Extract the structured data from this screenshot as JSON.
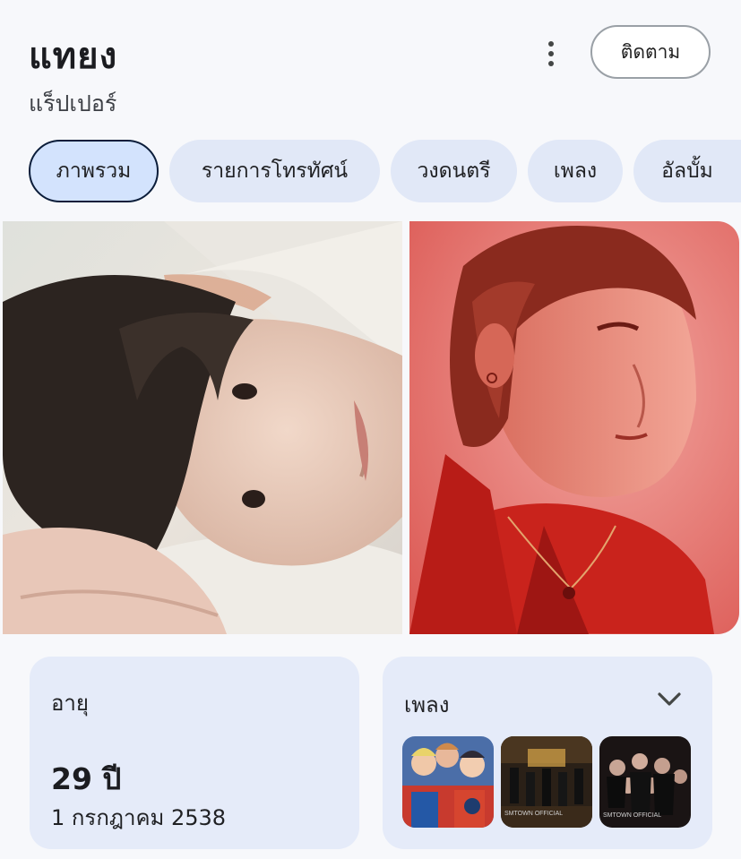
{
  "header": {
    "title": "แทยง",
    "subtitle": "แร็ปเปอร์",
    "follow_label": "ติดตาม"
  },
  "tabs": [
    {
      "label": "ภาพรวม",
      "active": true
    },
    {
      "label": "รายการโทรทัศน์",
      "active": false
    },
    {
      "label": "วงดนตรี",
      "active": false
    },
    {
      "label": "เพลง",
      "active": false
    },
    {
      "label": "อัลบั้ม",
      "active": false
    }
  ],
  "age_card": {
    "label": "อายุ",
    "value": "29 ปี",
    "birth_date": "1 กรกฎาคม 2538"
  },
  "songs_card": {
    "label": "เพลง",
    "thumbnail_captions": [
      "SMTOWN OFFICIAL",
      "SMTOWN OFFICIAL"
    ]
  },
  "colors": {
    "background": "#f7f8fb",
    "chip": "#e1e8f7",
    "chip_active": "#d3e3fd",
    "card": "#e5ebf9"
  }
}
